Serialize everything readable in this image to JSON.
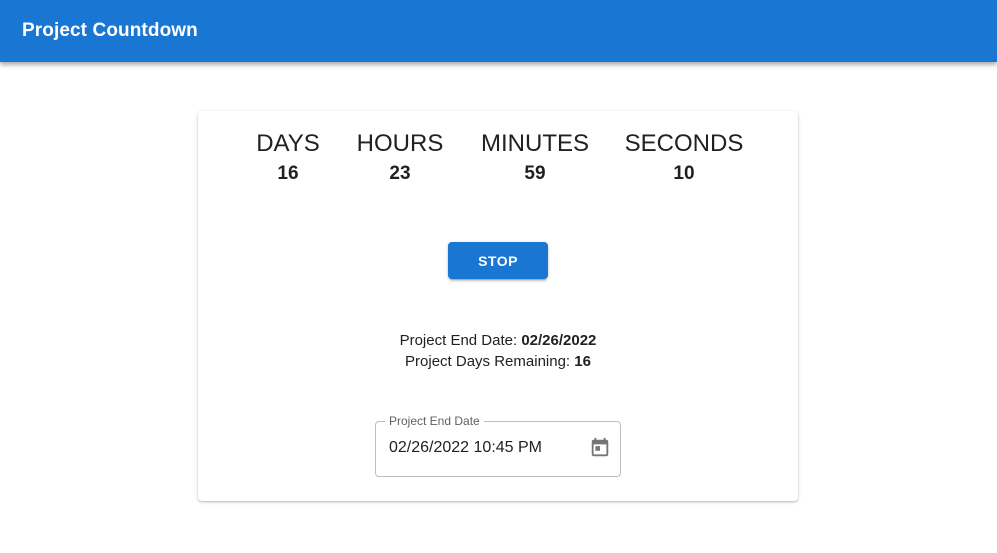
{
  "app": {
    "title": "Project Countdown",
    "accent_color": "#1976d2"
  },
  "countdown": {
    "units": [
      {
        "label": "DAYS",
        "value": "16"
      },
      {
        "label": "HOURS",
        "value": "23"
      },
      {
        "label": "MINUTES",
        "value": "59"
      },
      {
        "label": "SECONDS",
        "value": "10"
      }
    ],
    "stop_label": "STOP"
  },
  "summary": {
    "end_date_label": "Project End Date:",
    "end_date_value": "02/26/2022",
    "days_remaining_label": "Project Days Remaining:",
    "days_remaining_value": "16"
  },
  "date_field": {
    "label": "Project End Date",
    "value": "02/26/2022 10:45 PM",
    "icon": "calendar-icon"
  }
}
